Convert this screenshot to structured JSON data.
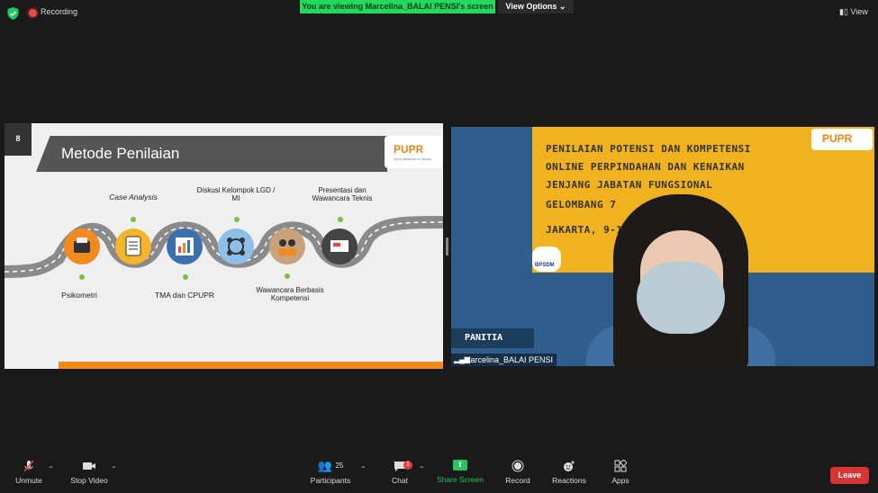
{
  "top_bar": {
    "recording_label": "Recording",
    "viewing_banner": "You are viewing Marcelina_BALAI PENSI's screen",
    "view_options_label": "View Options",
    "view_label": "View"
  },
  "slide": {
    "number": "8",
    "title": "Metode Penilaian",
    "logo_text": "PUPR",
    "logo_subtext": "SIGAP MEMBANGUN NEGERI",
    "steps": [
      {
        "label": "Psikometri",
        "icon": "typewriter-icon"
      },
      {
        "label": "Case Analysis",
        "icon": "notepad-icon"
      },
      {
        "label": "TMA dan CPUPR",
        "icon": "report-icon"
      },
      {
        "label": "Diskusi Kelompok LGD / MI",
        "icon": "group-discussion-icon"
      },
      {
        "label": "Wawancara Berbasis Kompetensi",
        "icon": "interview-icon"
      },
      {
        "label": "Presentasi dan Wawancara Teknis",
        "icon": "presentation-icon"
      }
    ],
    "colors": {
      "accent": "#f28a1e",
      "title_bar": "#555555",
      "step_dot": "#7ac142"
    }
  },
  "video": {
    "banner_lines": [
      "PENILAIAN POTENSI DAN KOMPETENSI",
      "ONLINE PERPINDAHAN DAN KENAIKAN",
      "JENJANG JABATAN FUNGSIONAL",
      "GELOMBANG 7",
      "JAKARTA, 9-10"
    ],
    "logo_text": "PUPR",
    "bpsdm_label": "BPSDM",
    "panitia_label": "PANITIA",
    "participant_name": "Marcelina_BALAI PENSI"
  },
  "toolbar": {
    "unmute": "Unmute",
    "stop_video": "Stop Video",
    "participants": "Participants",
    "participants_count": "25",
    "chat": "Chat",
    "chat_badge": "1",
    "share_screen": "Share Screen",
    "record": "Record",
    "reactions": "Reactions",
    "apps": "Apps",
    "leave": "Leave"
  }
}
